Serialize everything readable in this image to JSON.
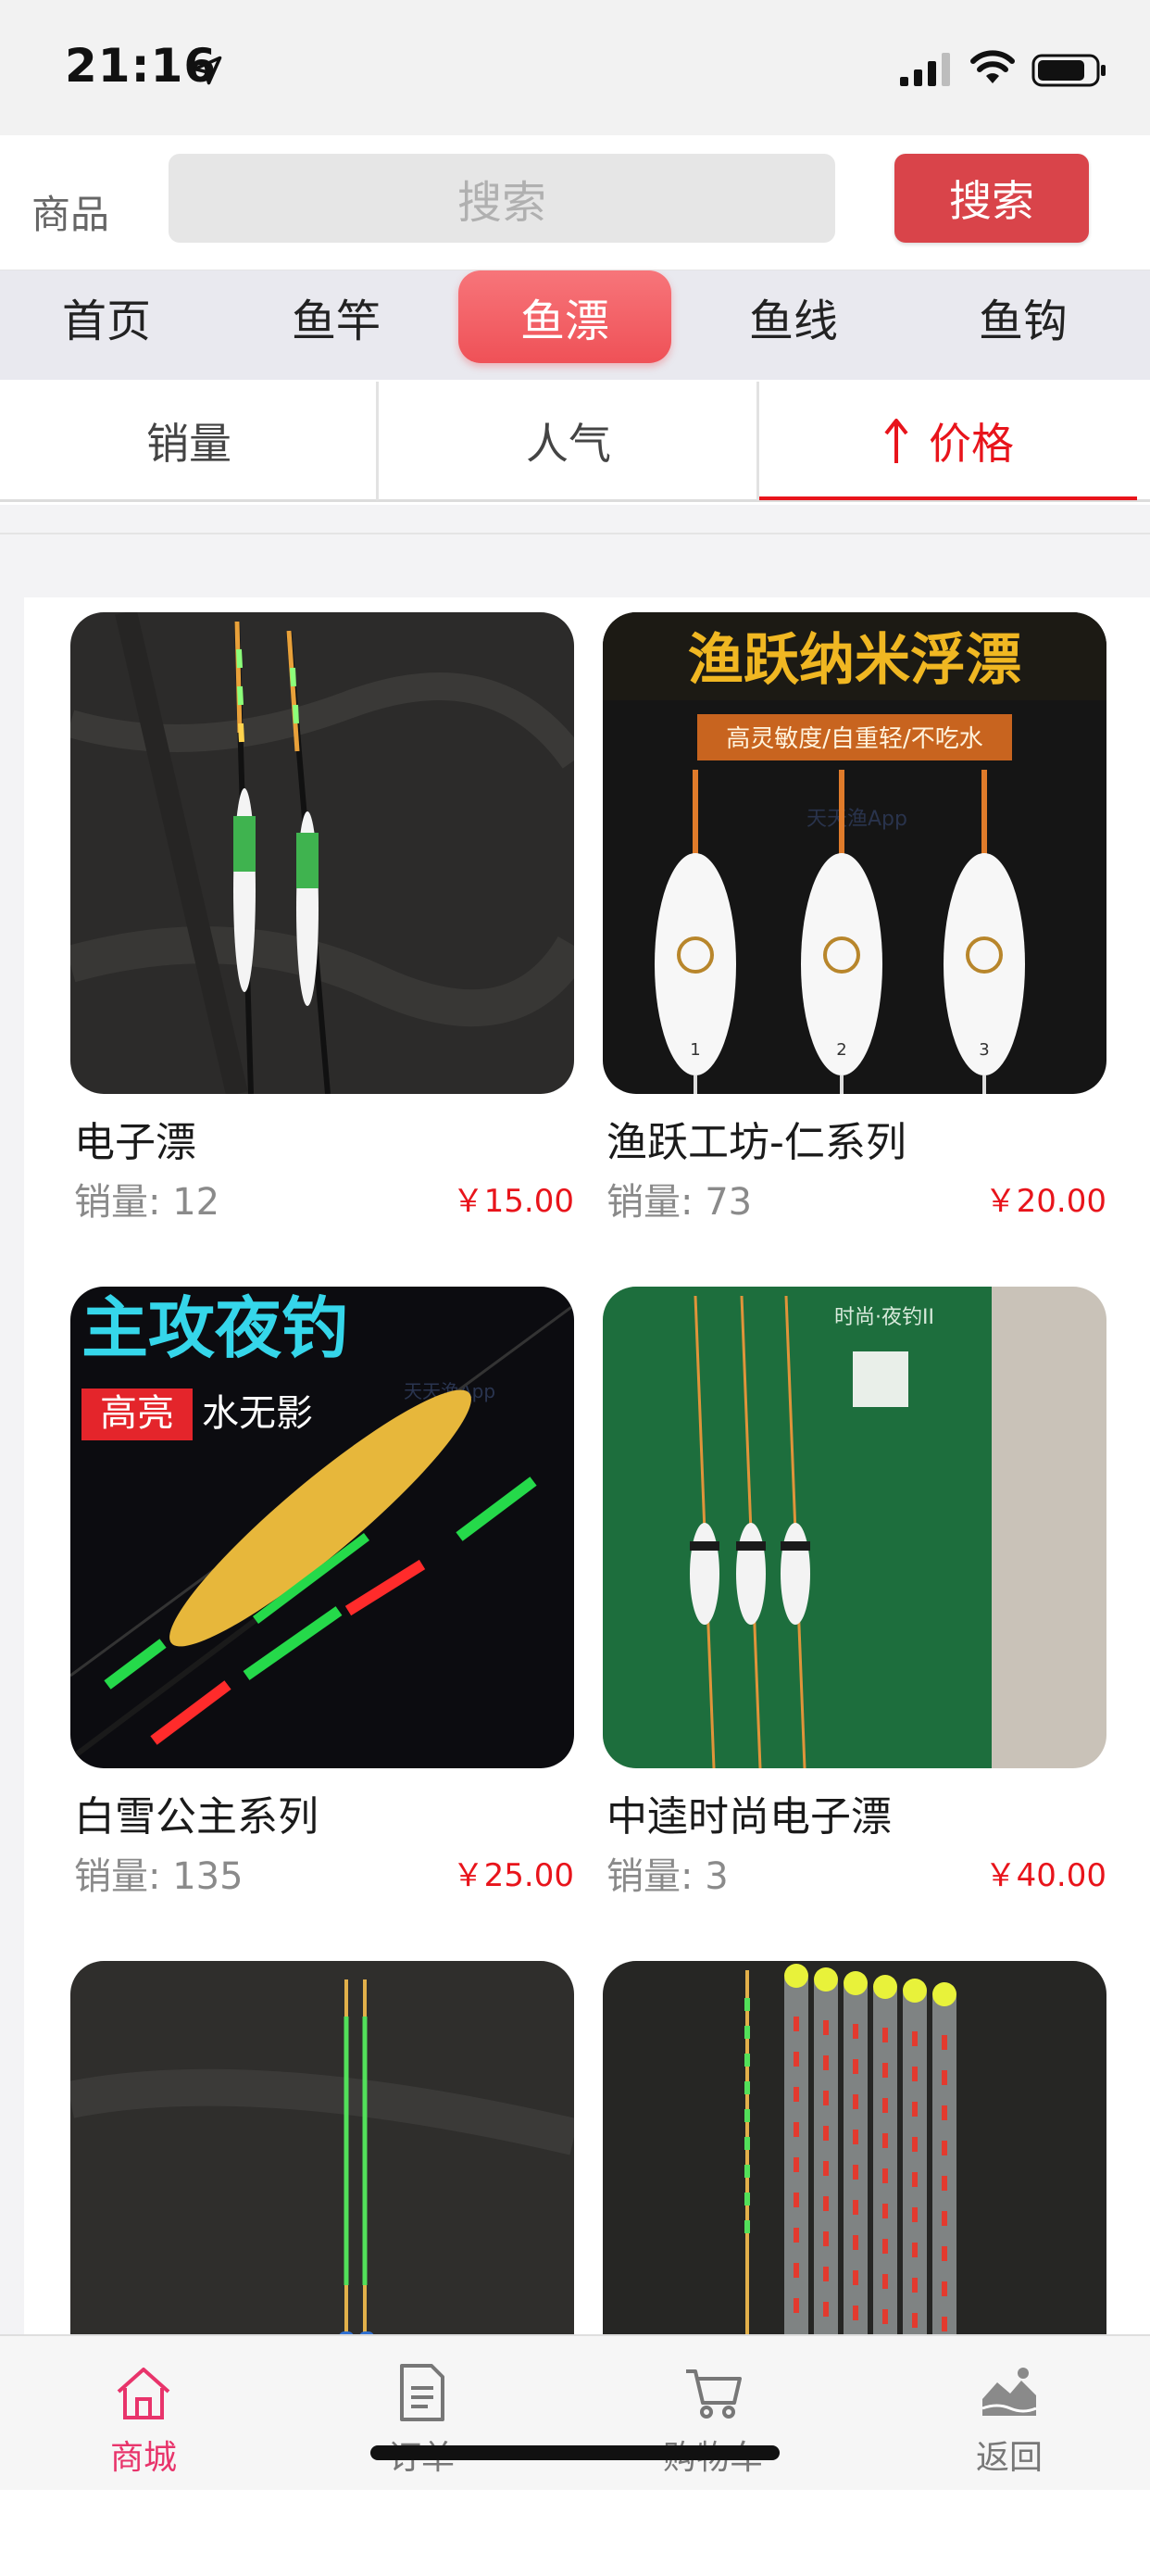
{
  "status_bar": {
    "time": "21:16"
  },
  "header": {
    "label": "商品",
    "search_placeholder": "搜索",
    "search_button": "搜索"
  },
  "categories": [
    {
      "label": "首页",
      "active": false
    },
    {
      "label": "鱼竿",
      "active": false
    },
    {
      "label": "鱼漂",
      "active": true
    },
    {
      "label": "鱼线",
      "active": false
    },
    {
      "label": "鱼钩",
      "active": false
    }
  ],
  "sort": {
    "sales": "销量",
    "popularity": "人气",
    "price": "价格",
    "active": "price",
    "direction": "ascending"
  },
  "products": [
    {
      "name": "电子漂",
      "sales": "销量: 12",
      "price": "￥15.00",
      "image": "electronic-float-photo"
    },
    {
      "name": "渔跃工坊-仁系列",
      "sales": "销量: 73",
      "price": "￥20.00",
      "image": "yuyue-nano-float-banner",
      "image_text": {
        "headline": "渔跃纳米浮漂",
        "tagline": "高灵敏度/自重轻/不吃水",
        "watermark": "天天渔App",
        "nums": [
          "1",
          "2",
          "3"
        ]
      }
    },
    {
      "name": "白雪公主系列",
      "sales": "销量: 135",
      "price": "￥25.00",
      "image": "night-fishing-float-banner",
      "image_text": {
        "headline": "主攻夜钓",
        "badge": "高亮",
        "sub": "水无影",
        "watermark": "天天渔App"
      }
    },
    {
      "name": "中逵时尚电子漂",
      "sales": "销量: 3",
      "price": "￥40.00",
      "image": "green-box-float-photo",
      "image_text": {
        "box_title": "时尚·夜钓II"
      }
    },
    {
      "name": "",
      "sales": "",
      "price": "",
      "image": "twin-green-float-photo"
    },
    {
      "name": "",
      "sales": "",
      "price": "",
      "image": "float-tube-set-photo"
    }
  ],
  "tab_bar": [
    {
      "label": "商城",
      "icon": "home-icon",
      "active": true
    },
    {
      "label": "订单",
      "icon": "order-document-icon",
      "active": false
    },
    {
      "label": "购物车",
      "icon": "shopping-cart-icon",
      "active": false
    },
    {
      "label": "返回",
      "icon": "return-landscape-icon",
      "active": false
    }
  ],
  "colors": {
    "accent_red": "#e8141b",
    "search_button": "#d9444a",
    "category_active": "#ef5157",
    "tab_active": "#e8346b"
  }
}
